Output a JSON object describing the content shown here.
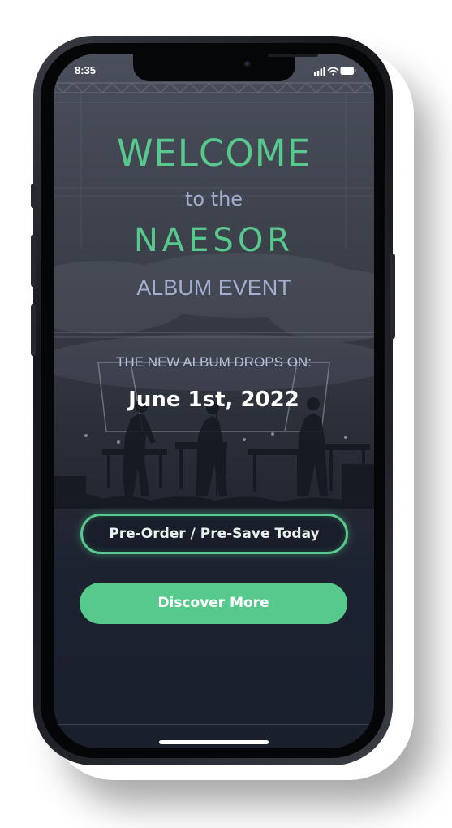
{
  "status_bar": {
    "time": "8:35",
    "icons": [
      "cellular-signal-icon",
      "wifi-icon",
      "battery-icon"
    ]
  },
  "hero": {
    "welcome": "WELCOME",
    "to_the": "to the",
    "brand": "NAESOR",
    "album_event": "ALBUM EVENT",
    "drop_label": "THE NEW ALBUM DROPS ON:",
    "drop_date": "June 1st, 2022"
  },
  "actions": {
    "preorder_label": "Pre-Order / Pre-Save Today",
    "discover_label": "Discover More"
  },
  "colors": {
    "accent_green": "#58c98d",
    "lavender_text": "#a4aed0",
    "background_dark": "#1a1f2c"
  }
}
